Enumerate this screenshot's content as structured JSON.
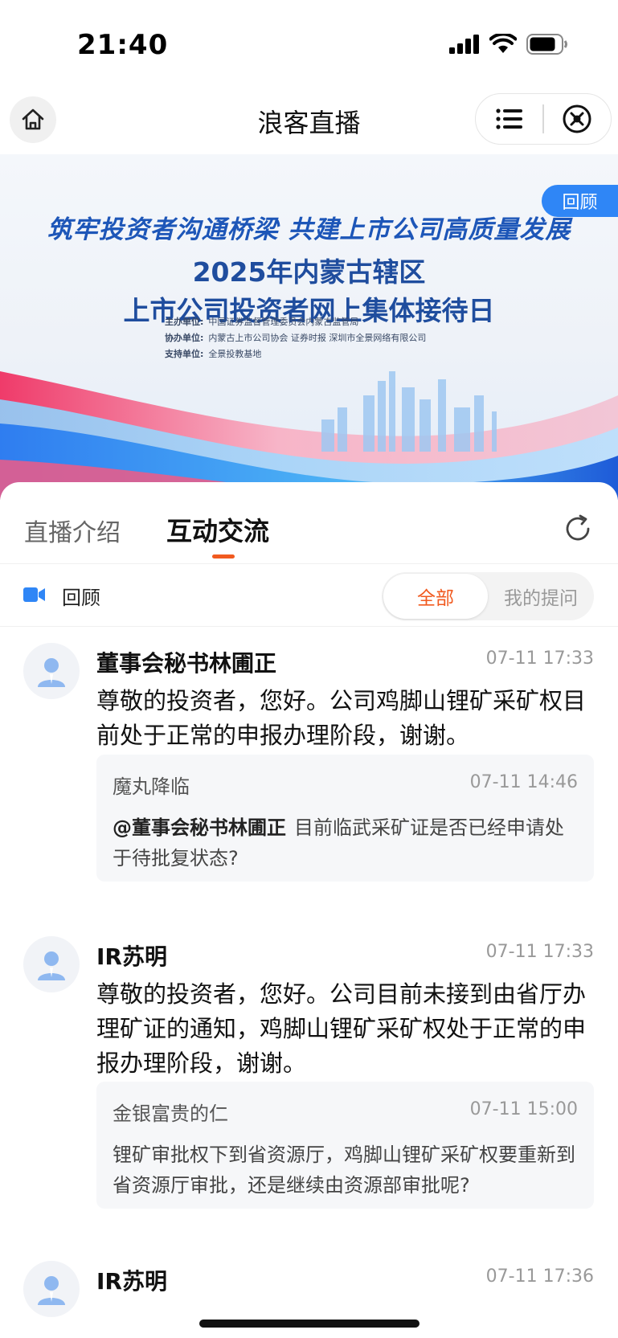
{
  "status": {
    "time": "21:40"
  },
  "nav": {
    "title": "浪客直播",
    "home_icon": "home-icon",
    "menu_icon": "menu-icon",
    "close_icon": "close-circle-icon"
  },
  "banner": {
    "slogan": "筑牢投资者沟通桥梁 共建上市公司高质量发展",
    "title_line1": "2025年内蒙古辖区",
    "title_line2": "上市公司投资者网上集体接待日",
    "orgs": [
      {
        "label": "主办单位:",
        "value": "中国证券监督管理委员会内蒙古监管局"
      },
      {
        "label": "协办单位:",
        "value": "内蒙古上市公司协会  证券时报  深圳市全景网络有限公司"
      },
      {
        "label": "支持单位:",
        "value": "全景投教基地"
      }
    ],
    "badge": "回顾"
  },
  "tabs": {
    "intro": "直播介绍",
    "interact": "互动交流",
    "refresh_icon": "refresh-icon"
  },
  "filter": {
    "label": "回顾",
    "video_icon": "video-camera-icon",
    "all": "全部",
    "mine": "我的提问"
  },
  "feed": [
    {
      "author": "董事会秘书林圃正",
      "time": "07-11 17:33",
      "answer": "尊敬的投资者，您好。公司鸡脚山锂矿采矿权目前处于正常的申报办理阶段，谢谢。",
      "question": {
        "user": "魔丸降临",
        "time": "07-11 14:46",
        "mention": "@董事会秘书林圃正",
        "text": "目前临武采矿证是否已经申请处于待批复状态?"
      }
    },
    {
      "author": "IR苏明",
      "time": "07-11 17:33",
      "answer": "尊敬的投资者，您好。公司目前未接到由省厅办理矿证的通知，鸡脚山锂矿采矿权处于正常的申报办理阶段，谢谢。",
      "question": {
        "user": "金银富贵的仁",
        "time": "07-11 15:00",
        "text": "锂矿审批权下到省资源厅，鸡脚山锂矿采矿权要重新到省资源厅审批，还是继续由资源部审批呢?"
      }
    },
    {
      "author": "IR苏明",
      "time": "07-11 17:36"
    }
  ]
}
